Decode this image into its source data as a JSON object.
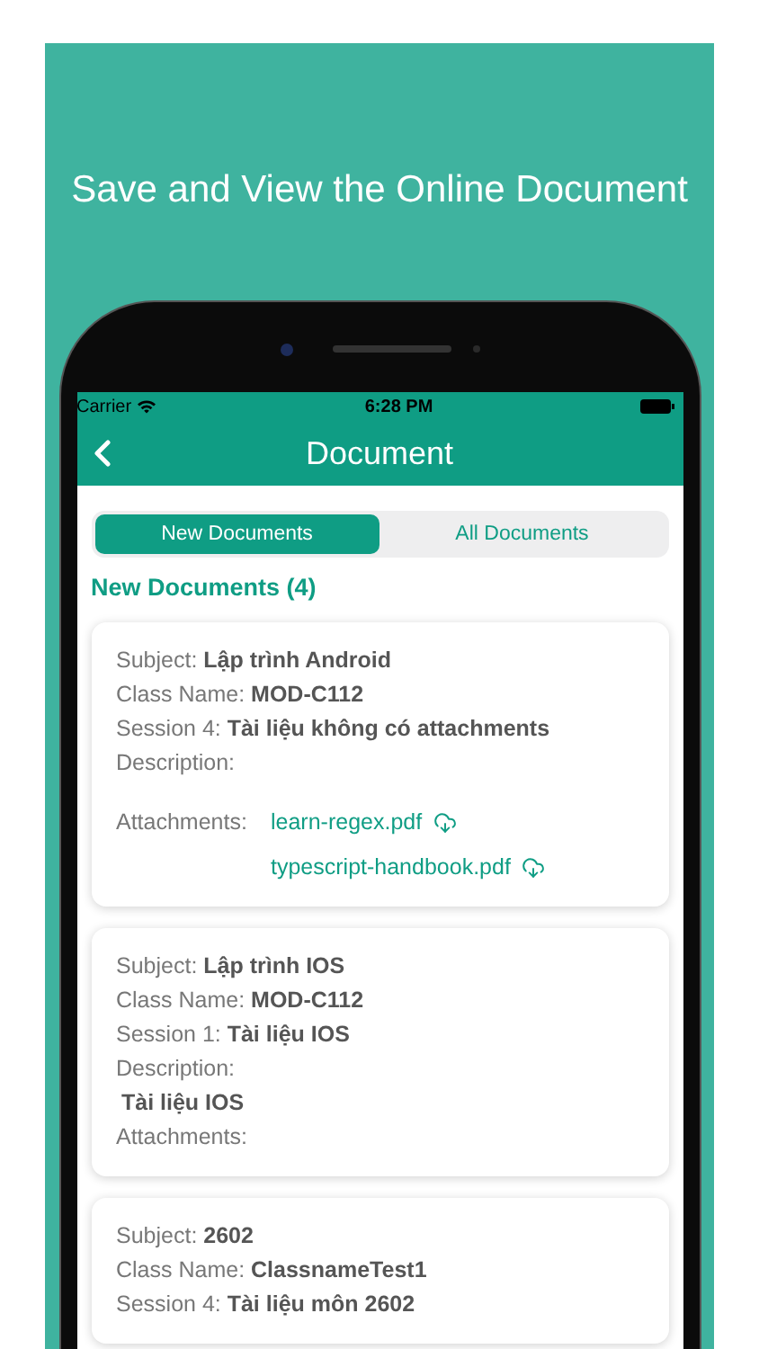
{
  "headline": "Save and View the Online Document",
  "status_bar": {
    "carrier": "Carrier",
    "time": "6:28 PM"
  },
  "nav_bar": {
    "title": "Document"
  },
  "tabs": [
    {
      "label": "New Documents",
      "selected": true
    },
    {
      "label": "All Documents",
      "selected": false
    }
  ],
  "section_title": "New Documents (4)",
  "cards": [
    {
      "lines": [
        {
          "kind": "field",
          "text": "Subject: **Lập trình Android**"
        },
        {
          "kind": "field",
          "text": "Class Name: **MOD-C112**"
        },
        {
          "kind": "field",
          "text": "Session 4: **Tài liệu không có attachments**"
        },
        {
          "kind": "field",
          "text": "Description:"
        },
        {
          "kind": "attachments",
          "label": "Attachments:",
          "files": [
            "learn-regex.pdf",
            "typescript-handbook.pdf"
          ]
        }
      ]
    },
    {
      "lines": [
        {
          "kind": "field",
          "text": "Subject: **Lập trình IOS**"
        },
        {
          "kind": "field",
          "text": "Class Name: **MOD-C112**"
        },
        {
          "kind": "field",
          "text": "Session 1: **Tài liệu IOS**"
        },
        {
          "kind": "field",
          "text": "Description:"
        },
        {
          "kind": "note",
          "text": "Tài liệu IOS"
        },
        {
          "kind": "attachments",
          "label": "Attachments:"
        }
      ]
    },
    {
      "lines": [
        {
          "kind": "field",
          "text": "Subject: **2602**"
        },
        {
          "kind": "field",
          "text": "Class Name: **ClassnameTest1**"
        },
        {
          "kind": "field",
          "text": "Session 4: **Tài liệu môn 2602**"
        }
      ]
    }
  ]
}
